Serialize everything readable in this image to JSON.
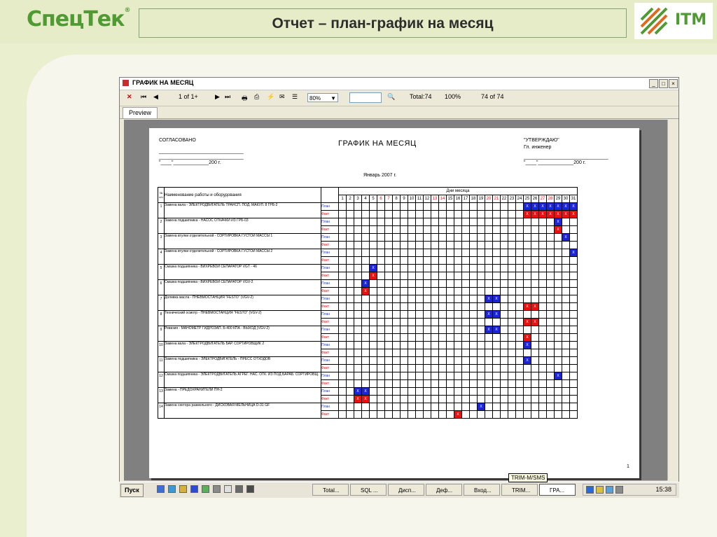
{
  "slide": {
    "logo_left": "СпецТек",
    "title": "Отчет – план-график на месяц",
    "logo_right": "ITM",
    "colors": {
      "brand_green": "#4f9a33",
      "plan_mark": "#1c24d8",
      "fact_mark": "#ea1010"
    }
  },
  "window": {
    "title": "ГРАФИК НА МЕСЯЦ",
    "toolbar": {
      "page_indicator": "1 of 1+",
      "zoom": "80%",
      "total": "Total:74",
      "percent": "100%",
      "count": "74 of 74"
    },
    "tab": "Preview"
  },
  "report": {
    "approved_left": "СОГЛАСОВАНО",
    "approved_right": "\"УТВЕРЖДАЮ\"",
    "chief": "Гл. инженер",
    "date_line": "\"____\"_____________200    г.",
    "title": "ГРАФИК НА МЕСЯЦ",
    "period": "Январь 2007 г.",
    "col_num": "№ п/п",
    "col_name": "Наименование работы и оборудования",
    "col_days": "Дни месяца",
    "page_number": "1",
    "days": [
      "1",
      "2",
      "3",
      "4",
      "5",
      "6",
      "7",
      "8",
      "9",
      "10",
      "11",
      "12",
      "13",
      "14",
      "15",
      "16",
      "17",
      "18",
      "19",
      "20",
      "21",
      "22",
      "23",
      "24",
      "25",
      "26",
      "27",
      "28",
      "29",
      "30",
      "31"
    ],
    "red_days": [
      "6",
      "7",
      "13",
      "14",
      "20",
      "21",
      "27",
      "28"
    ],
    "plan_label": "План",
    "fact_label": "Факт",
    "rows": [
      {
        "num": "1",
        "name": "Замена вала - ЭЛЕКТРОДВИГАТЕЛЬ ТРАНСП. ПОД. МАКУЛ. 8 ГРБ-2",
        "plan": [
          25,
          26,
          27,
          28,
          29,
          30,
          31
        ],
        "fact": [
          25,
          26,
          27,
          28,
          29,
          30,
          31
        ]
      },
      {
        "num": "2",
        "name": "Замена подшипника - НАСОС ОТКАЧКИ ИЗ ГРБ-03",
        "plan": [
          29
        ],
        "fact": [
          29
        ]
      },
      {
        "num": "3",
        "name": "Замена втулки отделительной - СОРТИРОВКА ГУСТОЙ МАССЫ 1",
        "plan": [
          30
        ],
        "fact": []
      },
      {
        "num": "4",
        "name": "Замена втулки отделительной - СОРТИРОВКА ГУСТОЙ МАССЫ 2",
        "plan": [
          31
        ],
        "fact": []
      },
      {
        "num": "5",
        "name": "Смазка подшипника - ВИХРЕВОИ СЕПАРАТОР VGT - 46",
        "plan": [
          5
        ],
        "fact": [
          5
        ]
      },
      {
        "num": "6",
        "name": "Смазка подшипника - ВИХРЕВОИ СЕПАРАТОР VGV-2",
        "plan": [
          4
        ],
        "fact": [
          4
        ]
      },
      {
        "num": "7",
        "name": "Доливка масла - ПНЕВМОСТАНЦИЯ \"FESTO\" (VGV-2)",
        "plan": [
          20,
          21
        ],
        "fact": [
          25,
          26
        ]
      },
      {
        "num": "8",
        "name": "Технический осмотр - ПНЕВМОСТАНЦИЯ \"FESTO\" (VGV-2)",
        "plan": [
          20,
          21
        ],
        "fact": [
          25,
          26
        ]
      },
      {
        "num": "9",
        "name": "Ревизия - МАНОМЕТР ГИДРОЗАП. Б-400 КПА - ВЫХОД (VGV-2)",
        "plan": [
          20,
          21
        ],
        "fact": [
          25
        ]
      },
      {
        "num": "10",
        "name": "Замена вала - ЭЛЕКТРОДВИГАТЕЛЬ БАР. СОРТИРОВЩИК 2",
        "plan": [
          25
        ],
        "fact": []
      },
      {
        "num": "11",
        "name": "Замена подшипника - ЭЛЕКТРОДВИГАТЕЛЬ - ПРЕСС ОТХОДОВ",
        "plan": [
          25
        ],
        "fact": []
      },
      {
        "num": "12",
        "name": "Смазка подшипника - ЭЛЕКТРОДВИГАТЕЛЬ АГРЕГ. НАС. ОТК. ИЗ ПОД БАРАБ. СОРТИРОВЩ.",
        "plan": [
          29
        ],
        "fact": []
      },
      {
        "num": "13",
        "name": "Замена - ПРЕДОХРАНИТЕЛИ ПН-2",
        "plan": [
          3,
          4
        ],
        "fact": [
          3,
          4
        ]
      },
      {
        "num": "14",
        "name": "Замена сектора размольного - ДИСКОВАЯ МЕЛЬНИЦА D-31 GF",
        "plan": [
          19
        ],
        "fact": [
          16
        ]
      }
    ]
  },
  "taskbar": {
    "start": "Пуск",
    "buttons": [
      "Total...",
      "SQL ...",
      "Дисп...",
      "Деф...",
      "Вход...",
      "TRIM...",
      "ГРА..."
    ],
    "active_index": 6,
    "tooltip": "TRIM-M/SMS",
    "clock": "15:38"
  }
}
